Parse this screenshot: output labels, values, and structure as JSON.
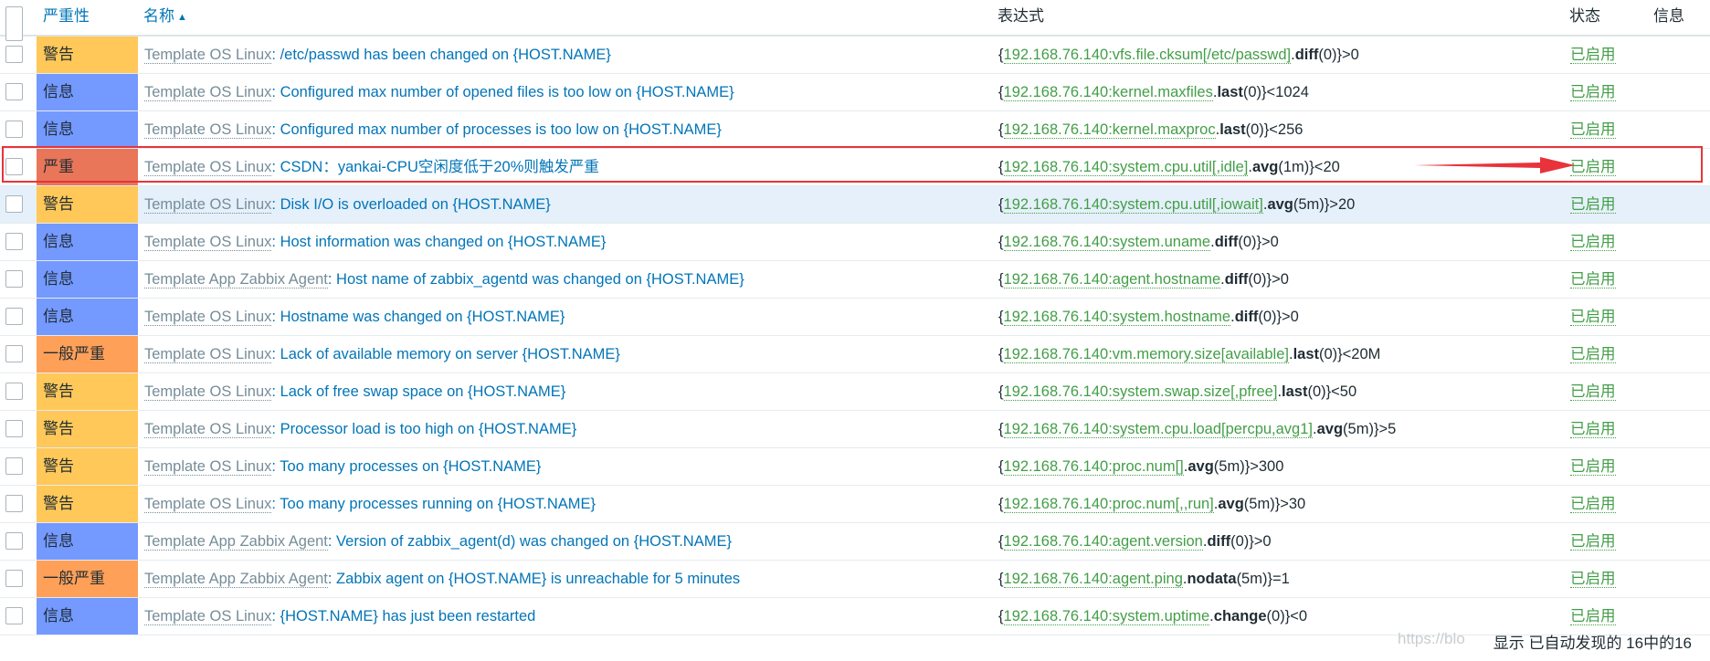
{
  "header": {
    "severity": "严重性",
    "name": "名称",
    "sort_arrow": "▲",
    "expression": "表达式",
    "status": "状态",
    "info": "信息"
  },
  "colors": {
    "warning": "#ffc859",
    "information": "#7499ff",
    "high": "#e97659",
    "average": "#ffa059",
    "enabled": "#429e47",
    "link": "#0275b8",
    "template": "#768d99",
    "highlight_border": "#e8333a"
  },
  "rows": [
    {
      "severity": "警告",
      "sev_level": "warning",
      "template": "Template OS Linux",
      "name": ": /etc/passwd has been changed on {HOST.NAME}",
      "expr_pre": "{",
      "expr_item": "192.168.76.140:vfs.file.cksum[/etc/passwd]",
      "expr_dot": ".",
      "expr_fn": "diff",
      "expr_post": "(0)}>0",
      "status": "已启用"
    },
    {
      "severity": "信息",
      "sev_level": "information",
      "template": "Template OS Linux",
      "name": ": Configured max number of opened files is too low on {HOST.NAME}",
      "expr_pre": "{",
      "expr_item": "192.168.76.140:kernel.maxfiles",
      "expr_dot": ".",
      "expr_fn": "last",
      "expr_post": "(0)}<1024",
      "status": "已启用"
    },
    {
      "severity": "信息",
      "sev_level": "information",
      "template": "Template OS Linux",
      "name": ": Configured max number of processes is too low on {HOST.NAME}",
      "expr_pre": "{",
      "expr_item": "192.168.76.140:kernel.maxproc",
      "expr_dot": ".",
      "expr_fn": "last",
      "expr_post": "(0)}<256",
      "status": "已启用"
    },
    {
      "severity": "严重",
      "sev_level": "high",
      "template": "Template OS Linux",
      "name": ": CSDN：yankai-CPU空闲度低于20%则触发严重",
      "expr_pre": "{",
      "expr_item": "192.168.76.140:system.cpu.util[,idle]",
      "expr_dot": ".",
      "expr_fn": "avg",
      "expr_post": "(1m)}<20",
      "status": "已启用"
    },
    {
      "severity": "警告",
      "sev_level": "warning",
      "template": "Template OS Linux",
      "name": ": Disk I/O is overloaded on {HOST.NAME}",
      "expr_pre": "{",
      "expr_item": "192.168.76.140:system.cpu.util[,iowait]",
      "expr_dot": ".",
      "expr_fn": "avg",
      "expr_post": "(5m)}>20",
      "status": "已启用"
    },
    {
      "severity": "信息",
      "sev_level": "information",
      "template": "Template OS Linux",
      "name": ": Host information was changed on {HOST.NAME}",
      "expr_pre": "{",
      "expr_item": "192.168.76.140:system.uname",
      "expr_dot": ".",
      "expr_fn": "diff",
      "expr_post": "(0)}>0",
      "status": "已启用"
    },
    {
      "severity": "信息",
      "sev_level": "information",
      "template": "Template App Zabbix Agent",
      "name": ": Host name of zabbix_agentd was changed on {HOST.NAME}",
      "expr_pre": "{",
      "expr_item": "192.168.76.140:agent.hostname",
      "expr_dot": ".",
      "expr_fn": "diff",
      "expr_post": "(0)}>0",
      "status": "已启用"
    },
    {
      "severity": "信息",
      "sev_level": "information",
      "template": "Template OS Linux",
      "name": ": Hostname was changed on {HOST.NAME}",
      "expr_pre": "{",
      "expr_item": "192.168.76.140:system.hostname",
      "expr_dot": ".",
      "expr_fn": "diff",
      "expr_post": "(0)}>0",
      "status": "已启用"
    },
    {
      "severity": "一般严重",
      "sev_level": "average",
      "template": "Template OS Linux",
      "name": ": Lack of available memory on server {HOST.NAME}",
      "expr_pre": "{",
      "expr_item": "192.168.76.140:vm.memory.size[available]",
      "expr_dot": ".",
      "expr_fn": "last",
      "expr_post": "(0)}<20M",
      "status": "已启用"
    },
    {
      "severity": "警告",
      "sev_level": "warning",
      "template": "Template OS Linux",
      "name": ": Lack of free swap space on {HOST.NAME}",
      "expr_pre": "{",
      "expr_item": "192.168.76.140:system.swap.size[,pfree]",
      "expr_dot": ".",
      "expr_fn": "last",
      "expr_post": "(0)}<50",
      "status": "已启用"
    },
    {
      "severity": "警告",
      "sev_level": "warning",
      "template": "Template OS Linux",
      "name": ": Processor load is too high on {HOST.NAME}",
      "expr_pre": "{",
      "expr_item": "192.168.76.140:system.cpu.load[percpu,avg1]",
      "expr_dot": ".",
      "expr_fn": "avg",
      "expr_post": "(5m)}>5",
      "status": "已启用"
    },
    {
      "severity": "警告",
      "sev_level": "warning",
      "template": "Template OS Linux",
      "name": ": Too many processes on {HOST.NAME}",
      "expr_pre": "{",
      "expr_item": "192.168.76.140:proc.num[]",
      "expr_dot": ".",
      "expr_fn": "avg",
      "expr_post": "(5m)}>300",
      "status": "已启用"
    },
    {
      "severity": "警告",
      "sev_level": "warning",
      "template": "Template OS Linux",
      "name": ": Too many processes running on {HOST.NAME}",
      "expr_pre": "{",
      "expr_item": "192.168.76.140:proc.num[,,run]",
      "expr_dot": ".",
      "expr_fn": "avg",
      "expr_post": "(5m)}>30",
      "status": "已启用"
    },
    {
      "severity": "信息",
      "sev_level": "information",
      "template": "Template App Zabbix Agent",
      "name": ": Version of zabbix_agent(d) was changed on {HOST.NAME}",
      "expr_pre": "{",
      "expr_item": "192.168.76.140:agent.version",
      "expr_dot": ".",
      "expr_fn": "diff",
      "expr_post": "(0)}>0",
      "status": "已启用"
    },
    {
      "severity": "一般严重",
      "sev_level": "average",
      "template": "Template App Zabbix Agent",
      "name": ": Zabbix agent on {HOST.NAME} is unreachable for 5 minutes",
      "expr_pre": "{",
      "expr_item": "192.168.76.140:agent.ping",
      "expr_dot": ".",
      "expr_fn": "nodata",
      "expr_post": "(5m)}=1",
      "status": "已启用"
    },
    {
      "severity": "信息",
      "sev_level": "information",
      "template": "Template OS Linux",
      "name": ": {HOST.NAME} has just been restarted",
      "expr_pre": "{",
      "expr_item": "192.168.76.140:system.uptime",
      "expr_dot": ".",
      "expr_fn": "change",
      "expr_post": "(0)}<0",
      "status": "已启用"
    }
  ],
  "highlight_row_index": 3,
  "hover_row_index": 4,
  "watermark": "https://blo",
  "footer": "显示 已自动发现的 16中的16"
}
